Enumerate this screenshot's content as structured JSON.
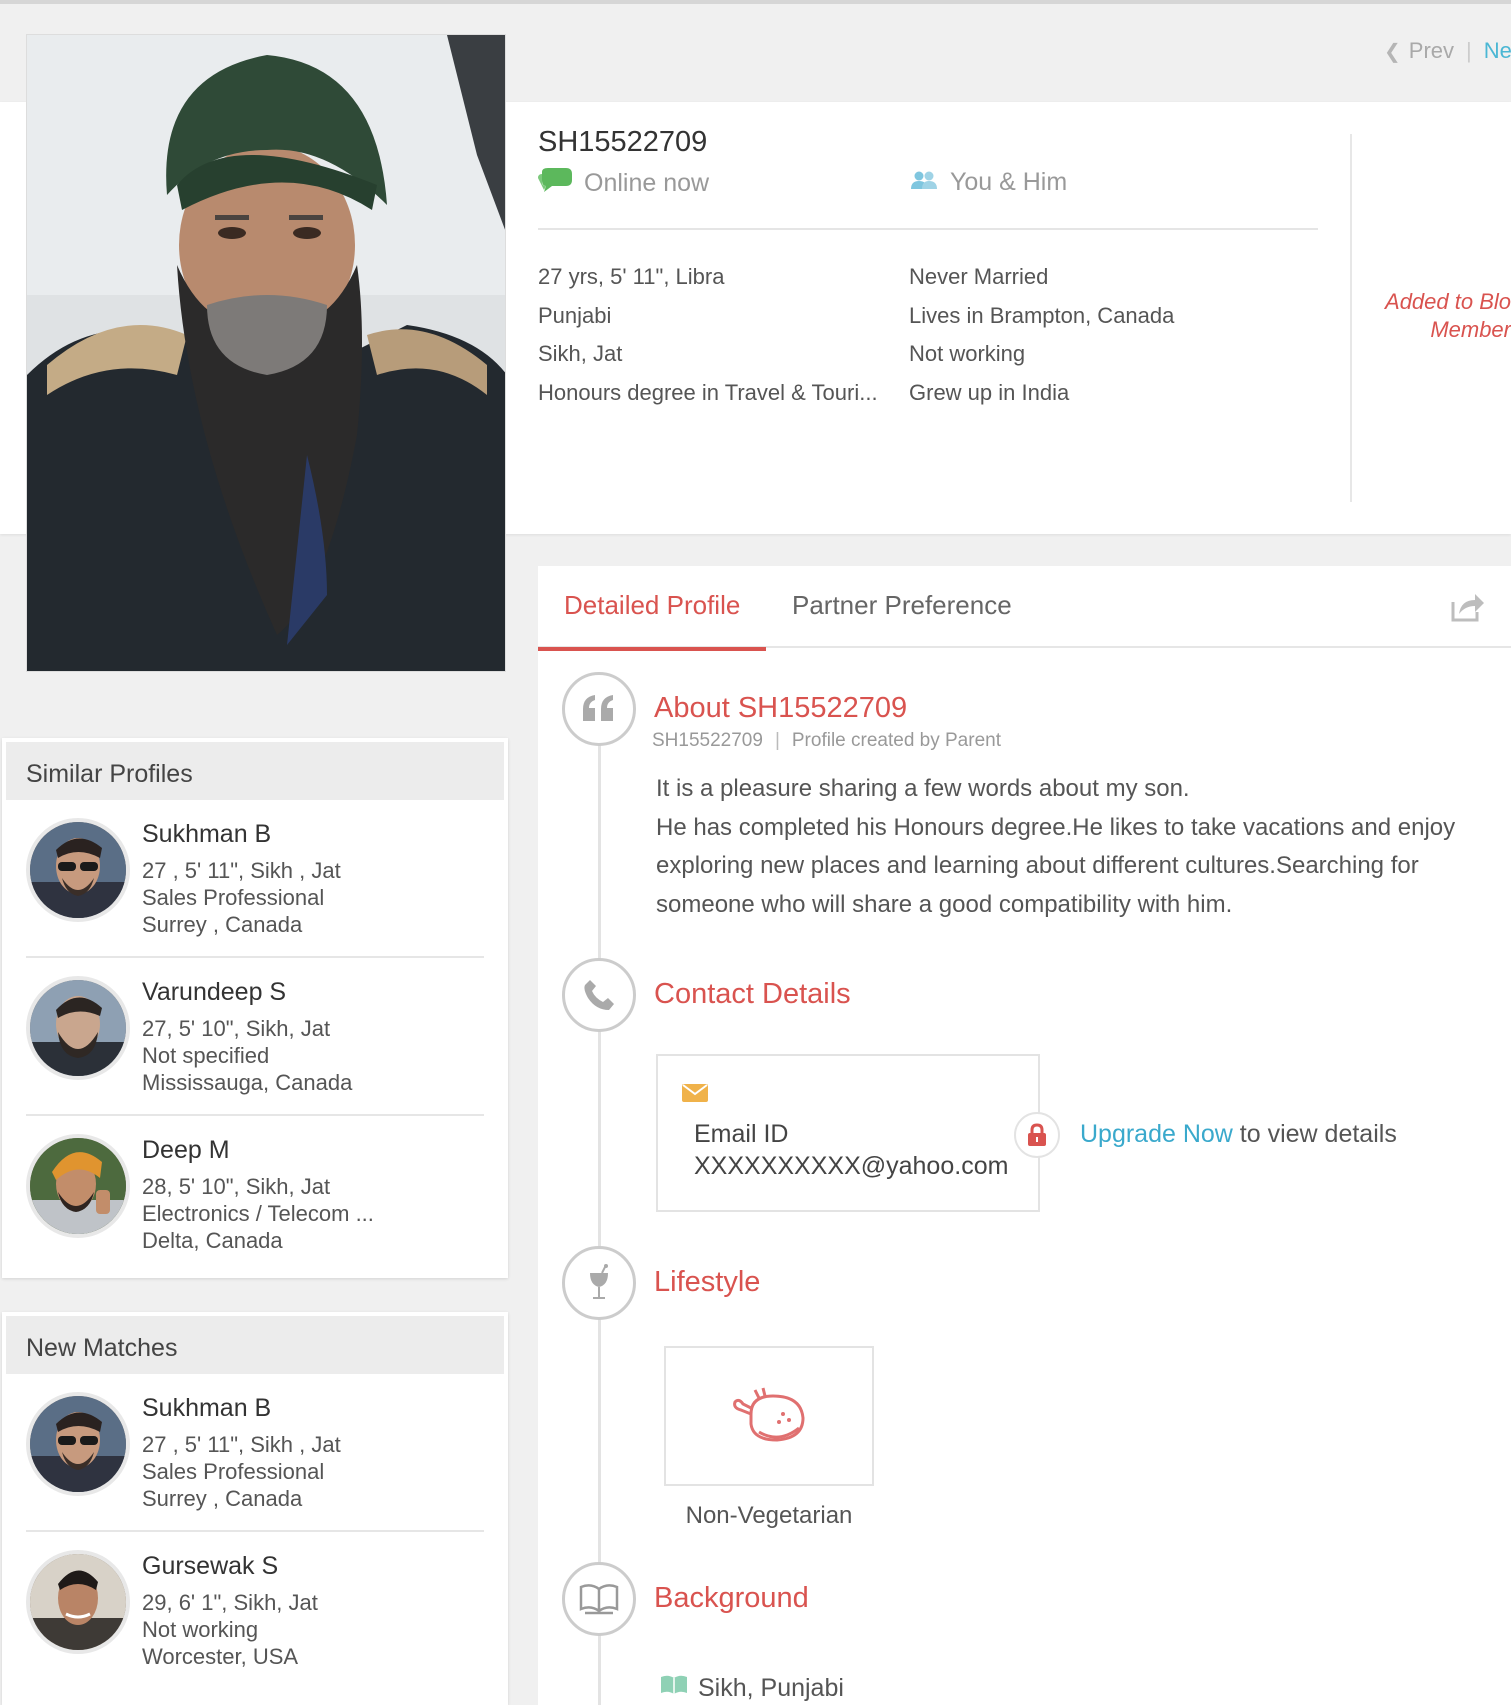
{
  "pager": {
    "prev_label": "Prev",
    "next_label": "Nex"
  },
  "profile": {
    "id": "SH15522709",
    "status": "Online now",
    "relation": "You & Him",
    "facts_left": [
      "27 yrs, 5' 11\", Libra",
      "Punjabi",
      "Sikh, Jat",
      "Honours degree in Travel & Touri..."
    ],
    "facts_right": [
      "Never Married",
      "Lives in Brampton, Canada",
      "Not working",
      "Grew up in India"
    ],
    "blocked_line1": "Added to Bloc",
    "blocked_line2": "Members"
  },
  "similar": {
    "title": "Similar Profiles",
    "items": [
      {
        "name": "Sukhman B",
        "line1": "27 , 5' 11\", Sikh , Jat",
        "line2": "Sales Professional",
        "line3": "Surrey , Canada"
      },
      {
        "name": "Varundeep S",
        "line1": "27, 5' 10\", Sikh, Jat",
        "line2": "Not specified",
        "line3": "Mississauga, Canada"
      },
      {
        "name": "Deep M",
        "line1": "28, 5' 10\", Sikh, Jat",
        "line2": "Electronics / Telecom ...",
        "line3": "Delta, Canada"
      }
    ]
  },
  "new_matches": {
    "title": "New Matches",
    "items": [
      {
        "name": "Sukhman B",
        "line1": "27 , 5' 11\", Sikh , Jat",
        "line2": "Sales Professional",
        "line3": "Surrey , Canada"
      },
      {
        "name": "Gursewak S",
        "line1": "29, 6' 1\", Sikh, Jat",
        "line2": "Not working",
        "line3": "Worcester, USA"
      }
    ]
  },
  "tabs": {
    "detailed": "Detailed Profile",
    "partner": "Partner Preference"
  },
  "about": {
    "title": "About SH15522709",
    "sub_id": "SH15522709",
    "sub_created": "Profile created by Parent",
    "text_line1": "It is a pleasure sharing a few words about my son.",
    "text_line2": "He has completed his Honours degree.He likes to take vacations and enjoy exploring new places and learning about different cultures.Searching for someone who will share a good compatibility with him."
  },
  "contact": {
    "title": "Contact Details",
    "email_label": "Email ID",
    "email_value": "XXXXXXXXXX@yahoo.com",
    "upgrade_link": "Upgrade Now",
    "upgrade_rest": " to view details"
  },
  "lifestyle": {
    "title": "Lifestyle",
    "diet": "Non-Vegetarian"
  },
  "background": {
    "title": "Background",
    "value": "Sikh, Punjabi"
  },
  "colors": {
    "accent": "#d9534f",
    "link": "#3aa9cc",
    "online": "#5cb85c"
  }
}
